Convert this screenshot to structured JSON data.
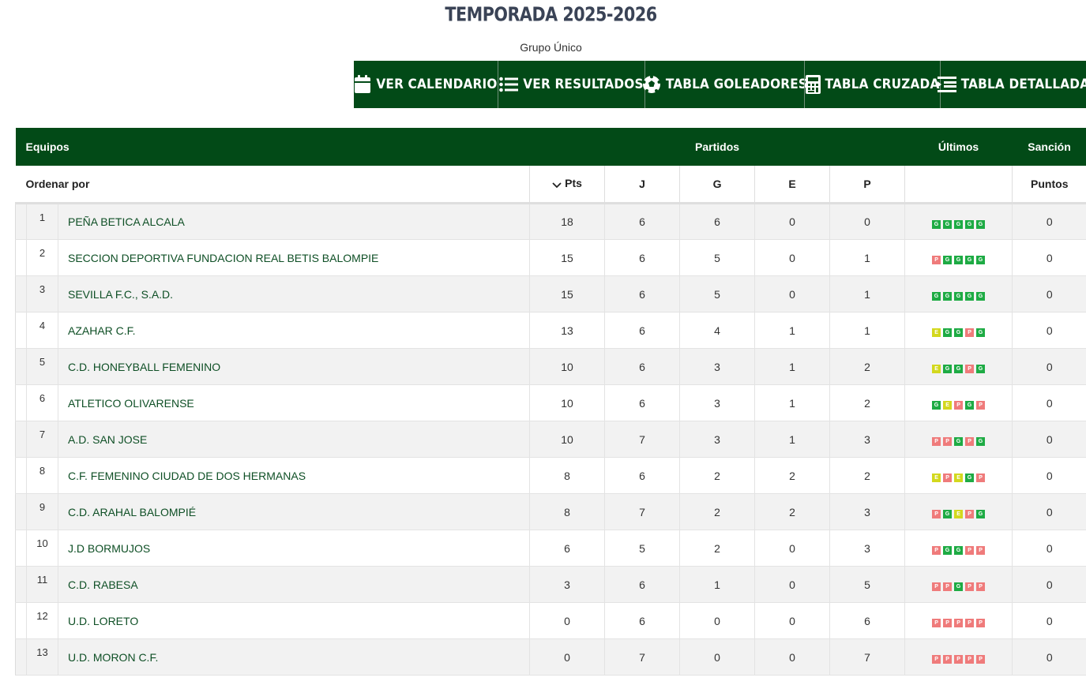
{
  "header": {
    "season_title": "TEMPORADA 2025-2026",
    "group": "Grupo Único"
  },
  "nav": [
    {
      "icon": "calendar-icon",
      "label": "VER CALENDARIO"
    },
    {
      "icon": "list-icon",
      "label": "VER RESULTADOS"
    },
    {
      "icon": "soccer-ball-icon",
      "label": "TABLA GOLEADORES"
    },
    {
      "icon": "calculator-icon",
      "label": "TABLA CRUZADA"
    },
    {
      "icon": "detailed-list-icon",
      "label": "TABLA DETALLADA"
    }
  ],
  "table": {
    "header": {
      "teams": "Equipos",
      "matches": "Partidos",
      "last": "Últimos",
      "sanction": "Sanción"
    },
    "sort_row": {
      "order_by": "Ordenar por",
      "pts": "Pts",
      "j": "J",
      "g": "G",
      "e": "E",
      "p": "P",
      "points": "Puntos"
    },
    "colors": {
      "header_bg": "#024a17",
      "win": "#1eab44",
      "draw": "#d3d81e",
      "loss": "#ef7b7b"
    },
    "rows": [
      {
        "pos": "1",
        "team": "PEÑA BETICA ALCALA",
        "pts": "18",
        "j": "6",
        "g": "6",
        "e": "0",
        "p": "0",
        "form": [
          "G",
          "G",
          "G",
          "G",
          "G"
        ],
        "sanction": "0"
      },
      {
        "pos": "2",
        "team": "SECCION DEPORTIVA FUNDACION REAL BETIS BALOMPIE",
        "pts": "15",
        "j": "6",
        "g": "5",
        "e": "0",
        "p": "1",
        "form": [
          "P",
          "G",
          "G",
          "G",
          "G"
        ],
        "sanction": "0"
      },
      {
        "pos": "3",
        "team": "SEVILLA F.C., S.A.D.",
        "pts": "15",
        "j": "6",
        "g": "5",
        "e": "0",
        "p": "1",
        "form": [
          "G",
          "G",
          "G",
          "G",
          "G"
        ],
        "sanction": "0"
      },
      {
        "pos": "4",
        "team": "AZAHAR C.F.",
        "pts": "13",
        "j": "6",
        "g": "4",
        "e": "1",
        "p": "1",
        "form": [
          "E",
          "G",
          "G",
          "P",
          "G"
        ],
        "sanction": "0"
      },
      {
        "pos": "5",
        "team": "C.D. HONEYBALL FEMENINO",
        "pts": "10",
        "j": "6",
        "g": "3",
        "e": "1",
        "p": "2",
        "form": [
          "E",
          "G",
          "G",
          "P",
          "G"
        ],
        "sanction": "0"
      },
      {
        "pos": "6",
        "team": "ATLETICO OLIVARENSE",
        "pts": "10",
        "j": "6",
        "g": "3",
        "e": "1",
        "p": "2",
        "form": [
          "G",
          "E",
          "P",
          "G",
          "P"
        ],
        "sanction": "0"
      },
      {
        "pos": "7",
        "team": "A.D. SAN JOSE",
        "pts": "10",
        "j": "7",
        "g": "3",
        "e": "1",
        "p": "3",
        "form": [
          "P",
          "P",
          "G",
          "P",
          "G"
        ],
        "sanction": "0"
      },
      {
        "pos": "8",
        "team": "C.F. FEMENINO CIUDAD DE DOS HERMANAS",
        "pts": "8",
        "j": "6",
        "g": "2",
        "e": "2",
        "p": "2",
        "form": [
          "E",
          "P",
          "E",
          "G",
          "P"
        ],
        "sanction": "0"
      },
      {
        "pos": "9",
        "team": "C.D. ARAHAL BALOMPIÉ",
        "pts": "8",
        "j": "7",
        "g": "2",
        "e": "2",
        "p": "3",
        "form": [
          "P",
          "G",
          "E",
          "P",
          "G"
        ],
        "sanction": "0"
      },
      {
        "pos": "10",
        "team": "J.D BORMUJOS",
        "pts": "6",
        "j": "5",
        "g": "2",
        "e": "0",
        "p": "3",
        "form": [
          "P",
          "G",
          "G",
          "P",
          "P"
        ],
        "sanction": "0"
      },
      {
        "pos": "11",
        "team": "C.D. RABESA",
        "pts": "3",
        "j": "6",
        "g": "1",
        "e": "0",
        "p": "5",
        "form": [
          "P",
          "P",
          "G",
          "P",
          "P"
        ],
        "sanction": "0"
      },
      {
        "pos": "12",
        "team": "U.D. LORETO",
        "pts": "0",
        "j": "6",
        "g": "0",
        "e": "0",
        "p": "6",
        "form": [
          "P",
          "P",
          "P",
          "P",
          "P"
        ],
        "sanction": "0"
      },
      {
        "pos": "13",
        "team": "U.D. MORON C.F.",
        "pts": "0",
        "j": "7",
        "g": "0",
        "e": "0",
        "p": "7",
        "form": [
          "P",
          "P",
          "P",
          "P",
          "P"
        ],
        "sanction": "0"
      }
    ]
  }
}
